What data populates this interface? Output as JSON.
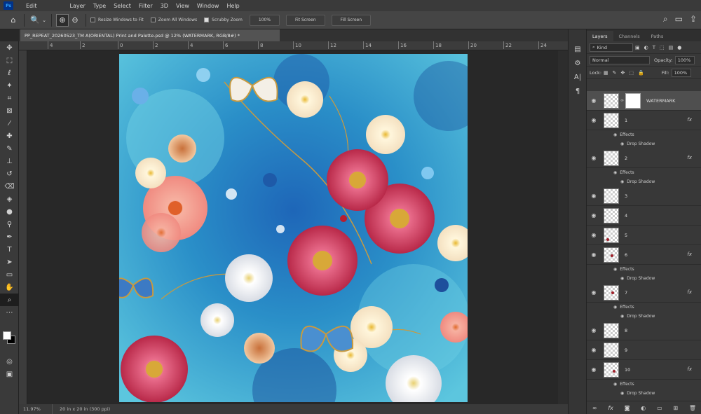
{
  "menubar": {
    "app_icon": "Ps",
    "items": [
      "Edit",
      "Layer",
      "Type",
      "Select",
      "Filter",
      "3D",
      "View",
      "Window",
      "Help"
    ]
  },
  "options": {
    "resize_windows": "Resize Windows to Fit",
    "zoom_all": "Zoom All Windows",
    "scrubby_zoom": "Scrubby Zoom",
    "zoom_value": "100%",
    "fit_screen": "Fit Screen",
    "fill_screen": "Fill Screen"
  },
  "document": {
    "tab_title": "PP_REPEAT_20260523_TM A(ORIENTAL) Print and Palette.psd @ 12% (WATERMARK, RGB/8#) *"
  },
  "ruler": {
    "ticks": [
      "4",
      "2",
      "0",
      "2",
      "4",
      "6",
      "8",
      "10",
      "12",
      "14",
      "16",
      "18",
      "20",
      "22",
      "24"
    ]
  },
  "status": {
    "zoom": "11.97%",
    "dims": "20 in x 20 in (300 ppi)"
  },
  "panel": {
    "tabs": [
      "Layers",
      "Channels",
      "Paths"
    ],
    "kind_label": "Kind",
    "blend_mode": "Normal",
    "opacity_label": "Opacity:",
    "opacity_value": "100%",
    "lock_label": "Lock:",
    "fill_label": "Fill:",
    "fill_value": "100%",
    "layers": [
      {
        "name": "WATERMARK",
        "selected": true,
        "mask": true,
        "fx": false
      },
      {
        "name": "1",
        "fx": true,
        "effects": "Effects",
        "shadow": "Drop Shadow"
      },
      {
        "name": "2",
        "fx": true,
        "effects": "Effects",
        "shadow": "Drop Shadow"
      },
      {
        "name": "3",
        "fx": false
      },
      {
        "name": "4",
        "fx": false
      },
      {
        "name": "5",
        "fx": false
      },
      {
        "name": "6",
        "fx": true,
        "effects": "Effects",
        "shadow": "Drop Shadow"
      },
      {
        "name": "7",
        "fx": true,
        "effects": "Effects",
        "shadow": "Drop Shadow"
      },
      {
        "name": "8",
        "fx": false
      },
      {
        "name": "9",
        "fx": false
      },
      {
        "name": "10",
        "fx": true,
        "effects": "Effects",
        "shadow": "Drop Shadow"
      }
    ]
  },
  "colors": {
    "accent": "#31a8ff",
    "canvas_bg": "#3aa4c8"
  }
}
